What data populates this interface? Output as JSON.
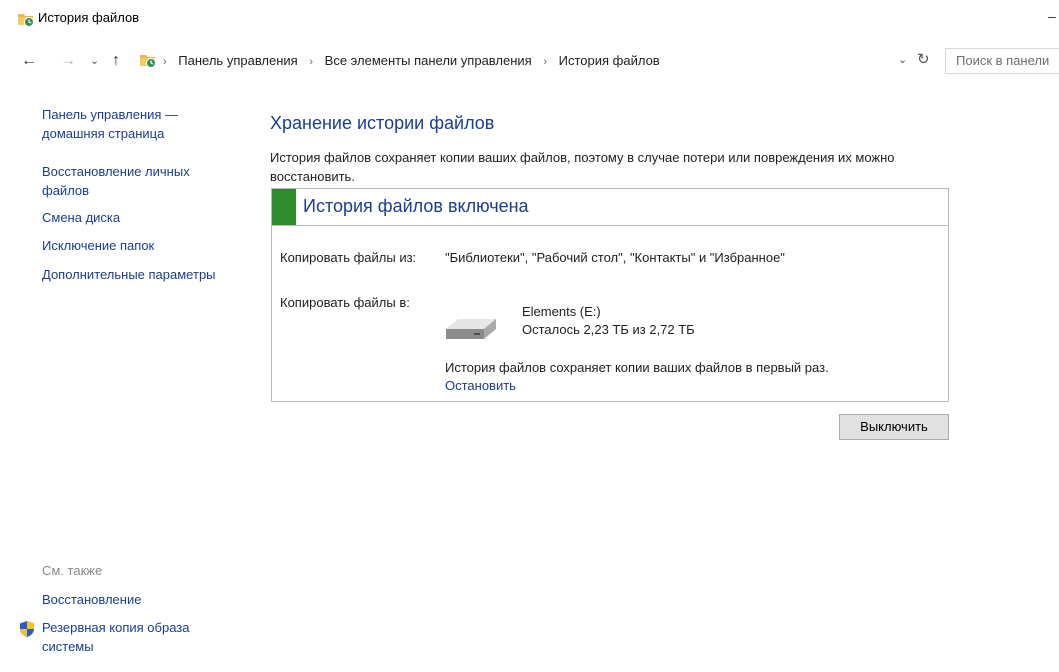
{
  "window": {
    "title": "История файлов",
    "minimize_glyph": "–"
  },
  "nav": {
    "back": "←",
    "forward": "→",
    "recent": "⌄",
    "up": "↑"
  },
  "address": {
    "crumbs": [
      "Панель управления",
      "Все элементы панели управления",
      "История файлов"
    ],
    "dropdown_glyph": "⌄",
    "refresh_glyph": "↻"
  },
  "search": {
    "placeholder": "Поиск в панели"
  },
  "sidebar": {
    "items": [
      {
        "label": "Панель управления —\nдомашняя страница"
      },
      {
        "label": "Восстановление личных\nфайлов"
      },
      {
        "label": "Смена диска"
      },
      {
        "label": "Исключение папок"
      },
      {
        "label": "Дополнительные параметры"
      }
    ],
    "see_also": "См. также",
    "links": [
      {
        "label": "Восстановление"
      },
      {
        "label": "Резервная копия образа\nсистемы"
      }
    ]
  },
  "main": {
    "heading": "Хранение истории файлов",
    "description": "История файлов сохраняет копии ваших файлов, поэтому в случае потери или повреждения их можно восстановить.",
    "status": {
      "title": "История файлов включена",
      "color": "#2e8b2e",
      "copy_from_label": "Копировать файлы из:",
      "copy_from_value": "\"Библиотеки\", \"Рабочий стол\", \"Контакты\" и \"Избранное\"",
      "copy_to_label": "Копировать файлы в:",
      "drive_name": "Elements (E:)",
      "drive_space": "Осталось 2,23 ТБ из 2,72 ТБ",
      "progress_message": "История файлов сохраняет копии ваших файлов в первый раз.",
      "stop_link": "Остановить"
    },
    "turn_off_button": "Выключить"
  },
  "colors": {
    "link": "#1a3d8f",
    "accent_green": "#2e8b2e"
  }
}
